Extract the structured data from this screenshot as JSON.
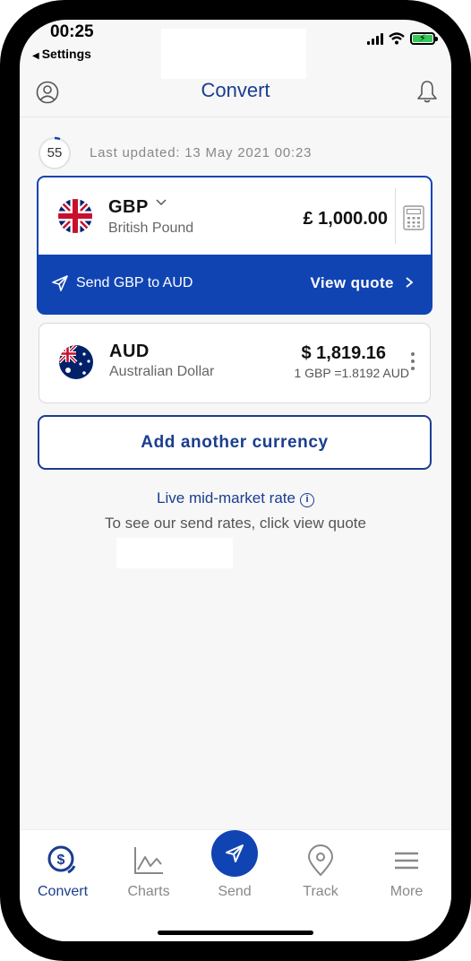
{
  "status_bar": {
    "time": "00:25",
    "back_label": "Settings"
  },
  "header": {
    "title": "Convert",
    "profile_icon": "user-circle-icon",
    "notification_icon": "bell-icon"
  },
  "refresh": {
    "countdown": "55",
    "last_updated": "Last updated: 13 May 2021 00:23"
  },
  "base_currency": {
    "code": "GBP",
    "name": "British Pound",
    "amount": "£ 1,000.00",
    "send_label": "Send GBP to AUD",
    "view_quote_label": "View quote"
  },
  "target_currency": {
    "code": "AUD",
    "name": "Australian Dollar",
    "amount": "$ 1,819.16",
    "rate": "1 GBP =1.8192 AUD"
  },
  "add_currency_label": "Add another currency",
  "live_rate_label": "Live mid-market rate",
  "send_rates_note": "To see our send rates, click view quote",
  "tabs": [
    {
      "label": "Convert",
      "icon": "dollar-coins-icon",
      "active": true
    },
    {
      "label": "Charts",
      "icon": "line-chart-icon",
      "active": false
    },
    {
      "label": "Send",
      "icon": "paper-plane-icon",
      "active": false
    },
    {
      "label": "Track",
      "icon": "map-pin-icon",
      "active": false
    },
    {
      "label": "More",
      "icon": "menu-icon",
      "active": false
    }
  ],
  "colors": {
    "brand_blue": "#1144b3",
    "text_blue": "#1a3d8f"
  }
}
